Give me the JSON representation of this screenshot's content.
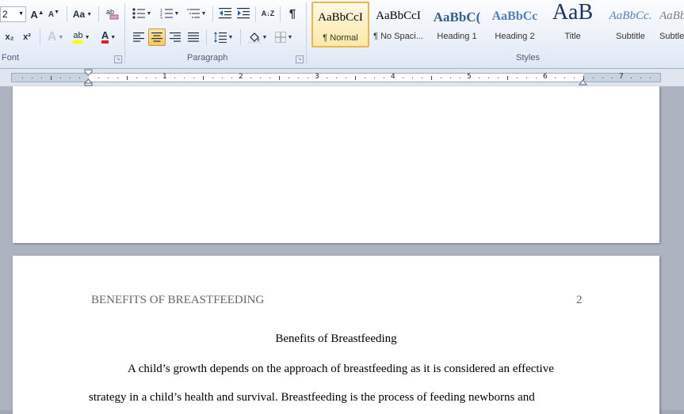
{
  "ribbon": {
    "font_size_value": "2",
    "font_group_label": "Font",
    "paragraph_group_label": "Paragraph",
    "styles_group_label": "Styles",
    "grow_font_label": "A",
    "shrink_font_label": "A",
    "change_case_label": "Aa",
    "subscript_label": "x₂",
    "superscript_label": "x²",
    "text_effects_label": "A",
    "highlight_label": "ab",
    "font_color_label": "A",
    "pilcrow_label": "¶",
    "sort_label": "A↓Z",
    "styles": [
      {
        "preview": "AaBbCcI",
        "name": "¶ Normal",
        "selected": true
      },
      {
        "preview": "AaBbCcI",
        "name": "¶ No Spaci..."
      },
      {
        "preview": "AaBbC(",
        "name": "Heading 1"
      },
      {
        "preview": "AaBbCc",
        "name": "Heading 2"
      },
      {
        "preview": "AaB",
        "name": "Title"
      },
      {
        "preview": "AaBbCc.",
        "name": "Subtitle"
      },
      {
        "preview": "AaBb",
        "name": "Subtle"
      }
    ],
    "colors": {
      "highlight": "#ffff00",
      "font_color": "#e02020",
      "heading": "#365f91",
      "heading2": "#4f81bd",
      "title": "#17365d"
    }
  },
  "ruler": {
    "numbers": [
      "1",
      "2",
      "3",
      "4",
      "5",
      "6",
      "7"
    ]
  },
  "document": {
    "header": "BENEFITS OF BREASTFEEDING",
    "page_number": "2",
    "title": "Benefits of Breastfeeding",
    "line1": "A child’s growth depends on the approach of breastfeeding as it is considered an effective",
    "line2": "strategy in a child’s health and survival.  Breastfeeding is the process of feeding newborns and"
  }
}
